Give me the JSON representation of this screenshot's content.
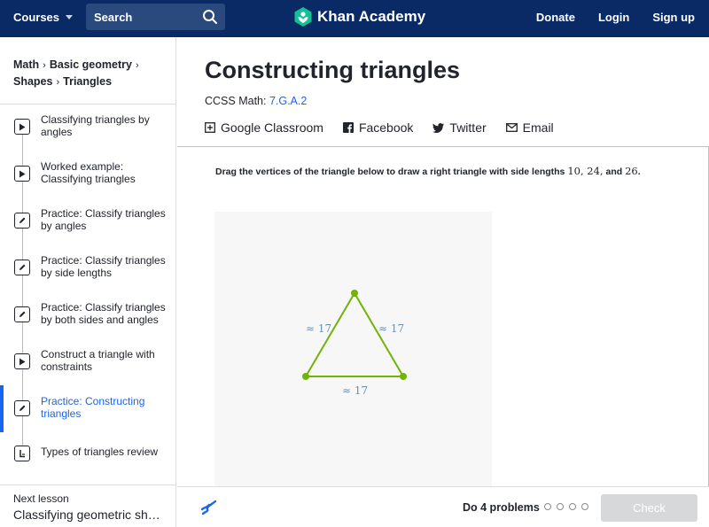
{
  "topbar": {
    "courses_label": "Courses",
    "search_placeholder": "Search",
    "logo_text": "Khan Academy",
    "donate": "Donate",
    "login": "Login",
    "signup": "Sign up"
  },
  "breadcrumb": {
    "items": [
      "Math",
      "Basic geometry",
      "Shapes",
      "Triangles"
    ]
  },
  "sidebar": {
    "items": [
      {
        "label": "Classifying triangles by angles",
        "icon": "play-icon"
      },
      {
        "label": "Worked example: Classifying triangles",
        "icon": "play-icon"
      },
      {
        "label": "Practice: Classify triangles by angles",
        "icon": "pencil-icon"
      },
      {
        "label": "Practice: Classify triangles by side lengths",
        "icon": "pencil-icon"
      },
      {
        "label": "Practice: Classify triangles by both sides and angles",
        "icon": "pencil-icon"
      },
      {
        "label": "Construct a triangle with constraints",
        "icon": "play-icon"
      },
      {
        "label": "Practice: Constructing triangles",
        "icon": "pencil-icon",
        "active": true
      },
      {
        "label": "Types of triangles review",
        "icon": "article-icon"
      }
    ],
    "next_label": "Next lesson",
    "next_title": "Classifying geometric shapes"
  },
  "main": {
    "title": "Constructing triangles",
    "ccss_prefix": "CCSS Math: ",
    "ccss_code": "7.G.A.2",
    "share": {
      "google": "Google Classroom",
      "facebook": "Facebook",
      "twitter": "Twitter",
      "email": "Email"
    },
    "prompt_text": "Drag the vertices of the triangle below to draw a right triangle with side lengths ",
    "prompt_math": "10, 24,",
    "prompt_and": " and ",
    "prompt_math2": "26",
    "prompt_end": ".",
    "side_left": "≈ 17",
    "side_right": "≈ 17",
    "side_bottom": "≈ 17"
  },
  "footer": {
    "do_problems": "Do 4 problems",
    "check": "Check",
    "progress_total": 4,
    "progress_done": 0
  },
  "colors": {
    "topbar": "#0a2a66",
    "accent": "#1865f2",
    "triangle": "#71b307",
    "exercise_border": "#f5b85a"
  }
}
